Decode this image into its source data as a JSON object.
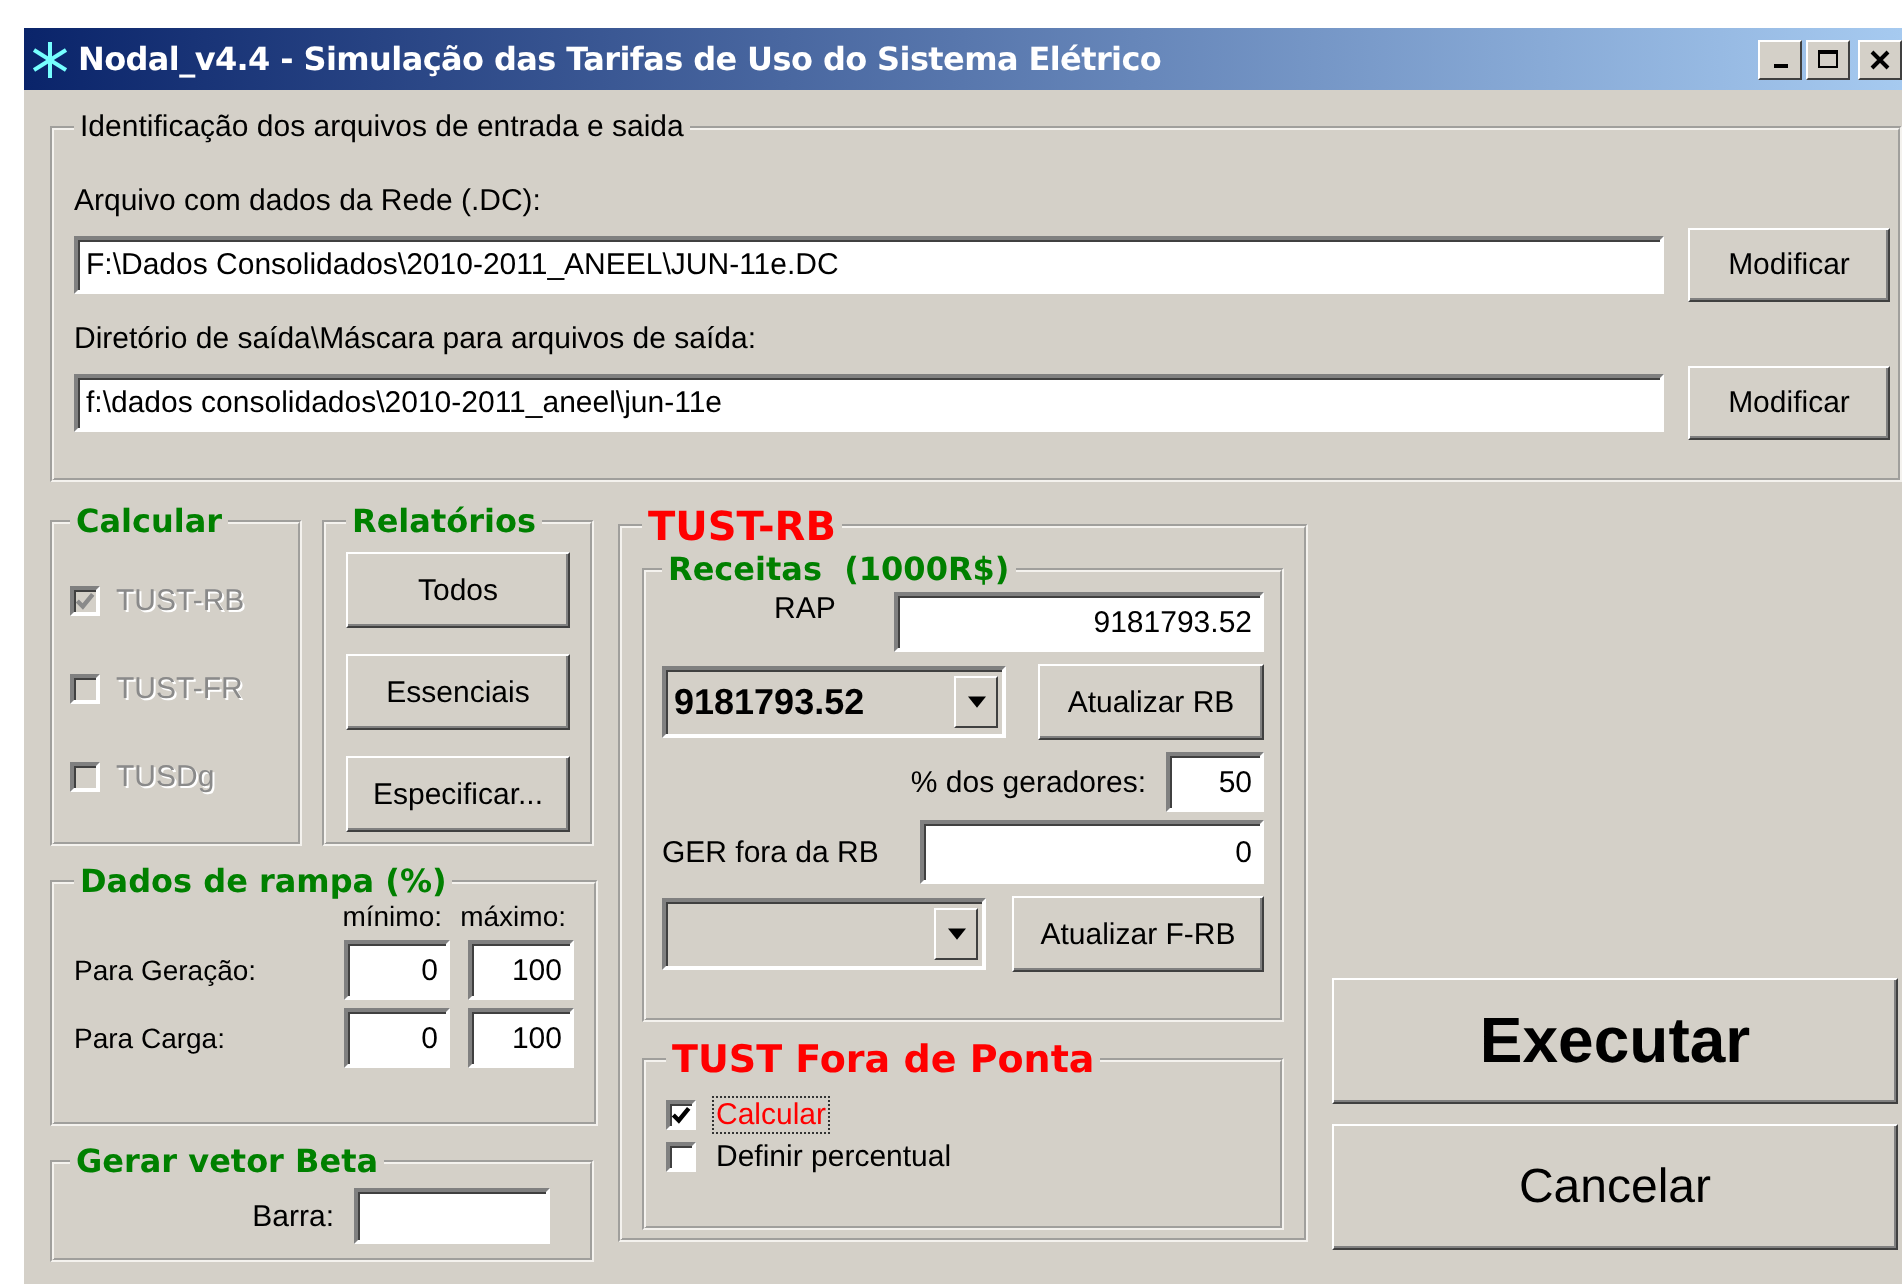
{
  "window": {
    "title": "Nodal_v4.4 - Simulação das Tarifas de Uso do Sistema Elétrico"
  },
  "files": {
    "legend": "Identificação dos arquivos de entrada e saida",
    "fields": [
      {
        "label": "Arquivo com dados da Rede (.DC):",
        "value": "F:\\Dados Consolidados\\2010-2011_ANEEL\\JUN-11e.DC",
        "button": "Modificar"
      },
      {
        "label": "Diretório de saída\\Máscara para arquivos de saída:",
        "value": "f:\\dados consolidados\\2010-2011_aneel\\jun-11e",
        "button": "Modificar"
      }
    ]
  },
  "calcular": {
    "legend": "Calcular",
    "options": [
      {
        "label": "TUST-RB",
        "checked": true,
        "disabled": true
      },
      {
        "label": "TUST-FR",
        "checked": false,
        "disabled": true
      },
      {
        "label": "TUSDg",
        "checked": false,
        "disabled": true
      }
    ]
  },
  "relatorios": {
    "legend": "Relatórios",
    "buttons": [
      "Todos",
      "Essenciais",
      "Especificar..."
    ]
  },
  "rampa": {
    "legend": "Dados de rampa (%)",
    "col_min": "mínimo:",
    "col_max": "máximo:",
    "rows": [
      {
        "label": "Para Geração:",
        "min": "0",
        "max": "100"
      },
      {
        "label": "Para Carga:",
        "min": "0",
        "max": "100"
      }
    ]
  },
  "beta": {
    "legend": "Gerar vetor Beta",
    "label": "Barra:"
  },
  "tust_rb": {
    "legend": "TUST-RB",
    "receitas": {
      "legend": "Receitas  (1000R$)",
      "rap_label": "RAP",
      "rap_value": "9181793.52",
      "combo_value": "9181793.52",
      "update_button": "Atualizar RB",
      "pct_label": "% dos geradores:",
      "pct_value": "50",
      "ger_label": "GER fora da RB",
      "ger_value": "0",
      "update_frb_button": "Atualizar F-RB"
    }
  },
  "fora_ponta": {
    "legend": "TUST Fora de Ponta",
    "options": [
      {
        "label": "Calcular",
        "checked": true,
        "focused": true
      },
      {
        "label": "Definir percentual",
        "checked": false,
        "focused": false
      }
    ]
  },
  "actions": [
    {
      "label": "Executar",
      "kind": "primary"
    },
    {
      "label": "Cancelar",
      "kind": "secondary"
    }
  ]
}
